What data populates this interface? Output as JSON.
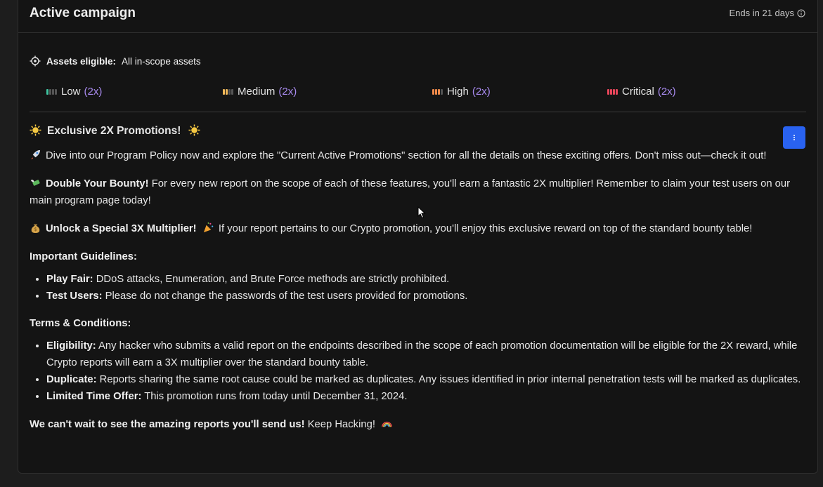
{
  "header": {
    "title": "Active campaign",
    "ends_text": "Ends in 21 days"
  },
  "assets": {
    "label": "Assets eligible:",
    "value": "All in-scope assets"
  },
  "severities": [
    {
      "name": "Low",
      "multiplier": "(2x)",
      "color": "#3ec4a0",
      "filled": 1
    },
    {
      "name": "Medium",
      "multiplier": "(2x)",
      "color": "#f0b85a",
      "filled": 2
    },
    {
      "name": "High",
      "multiplier": "(2x)",
      "color": "#f08a4a",
      "filled": 3
    },
    {
      "name": "Critical",
      "multiplier": "(2x)",
      "color": "#e8455a",
      "filled": 4
    }
  ],
  "content": {
    "promo_title": "Exclusive 2X Promotions!",
    "p1": "Dive into our Program Policy now and explore the \"Current Active Promotions\" section for all the details on these exciting offers. Don't miss out—check it out!",
    "p2_bold": "Double Your Bounty!",
    "p2": " For every new report on the scope of each of these features, you'll earn a fantastic 2X multiplier! Remember to claim your test users on our main program page today!",
    "p3_bold": "Unlock a Special 3X Multiplier!",
    "p3": " If your report pertains to our Crypto promotion, you'll enjoy this exclusive reward on top of the standard bounty table!",
    "guidelines_title": "Important Guidelines:",
    "guidelines": [
      {
        "bold": "Play Fair:",
        "text": " DDoS attacks, Enumeration, and Brute Force methods are strictly prohibited."
      },
      {
        "bold": "Test Users:",
        "text": " Please do not change the passwords of the test users provided for promotions."
      }
    ],
    "terms_title": "Terms & Conditions:",
    "terms": [
      {
        "bold": "Eligibility:",
        "text": " Any hacker who submits a valid report on the endpoints described in the scope of each promotion documentation will be eligible for the 2X reward, while Crypto reports will earn a 3X multiplier over the standard bounty table."
      },
      {
        "bold": "Duplicate:",
        "text": " Reports sharing the same root cause could be marked as duplicates. Any issues identified in prior internal penetration tests will be marked as duplicates."
      },
      {
        "bold": "Limited Time Offer:",
        "text": " This promotion runs from today until December 31, 2024."
      }
    ],
    "closing_bold": "We can't wait to see the amazing reports you'll send us!",
    "closing": " Keep Hacking!"
  },
  "icons": {
    "sun": "sun-emoji-icon",
    "rocket": "rocket-emoji-icon",
    "money_wings": "money-with-wings-emoji-icon",
    "money_bag": "money-bag-emoji-icon",
    "party": "party-popper-emoji-icon",
    "rainbow": "rainbow-emoji-icon",
    "menu": "kebab-menu-icon"
  },
  "accent": "#2962f0"
}
